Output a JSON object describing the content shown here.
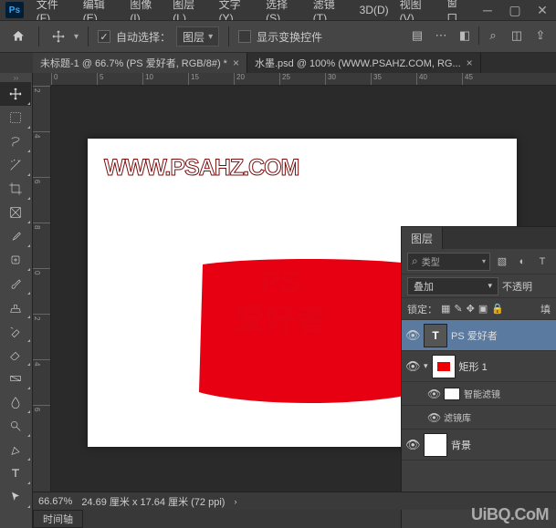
{
  "menu": {
    "items": [
      "文件(F)",
      "编辑(E)",
      "图像(I)",
      "图层(L)",
      "文字(Y)",
      "选择(S)",
      "滤镜(T)",
      "3D(D)",
      "视图(V)",
      "窗口"
    ]
  },
  "options": {
    "auto_select_label": "自动选择：",
    "target": "图层",
    "show_transform_label": "显示变换控件"
  },
  "tabs": {
    "active": "未标题-1 @ 66.7% (PS 爱好者, RGB/8#) *",
    "other": "水墨.psd @ 100% (WWW.PSAHZ.COM, RG..."
  },
  "ruler": {
    "h": [
      "0",
      "5",
      "10",
      "15",
      "20",
      "25",
      "30",
      "35",
      "40",
      "45"
    ],
    "v": [
      "2",
      "4",
      "6",
      "8",
      "0",
      "2",
      "4",
      "6"
    ]
  },
  "canvas": {
    "watermark": "WWW.PSAHZ.COM",
    "red_text_line1": "PS",
    "red_text_line2": "爱好者"
  },
  "status": {
    "zoom": "66.67%",
    "dims": "24.69 厘米 x 17.64 厘米 (72 ppi)",
    "timeline": "时间轴"
  },
  "layers_panel": {
    "tab": "图层",
    "search": "类型",
    "blend_mode": "叠加",
    "opacity_label": "不透明",
    "lock_label": "锁定：",
    "fill_label": "填",
    "layers": [
      {
        "name": "PS 爱好者",
        "type": "text",
        "selected": true
      },
      {
        "name": "矩形 1",
        "type": "rect"
      },
      {
        "name": "智能滤镜",
        "type": "smart"
      },
      {
        "name": "滤镜库",
        "type": "filter"
      },
      {
        "name": "背景",
        "type": "normal"
      }
    ]
  },
  "footer_watermark": "UiBQ.CoM"
}
